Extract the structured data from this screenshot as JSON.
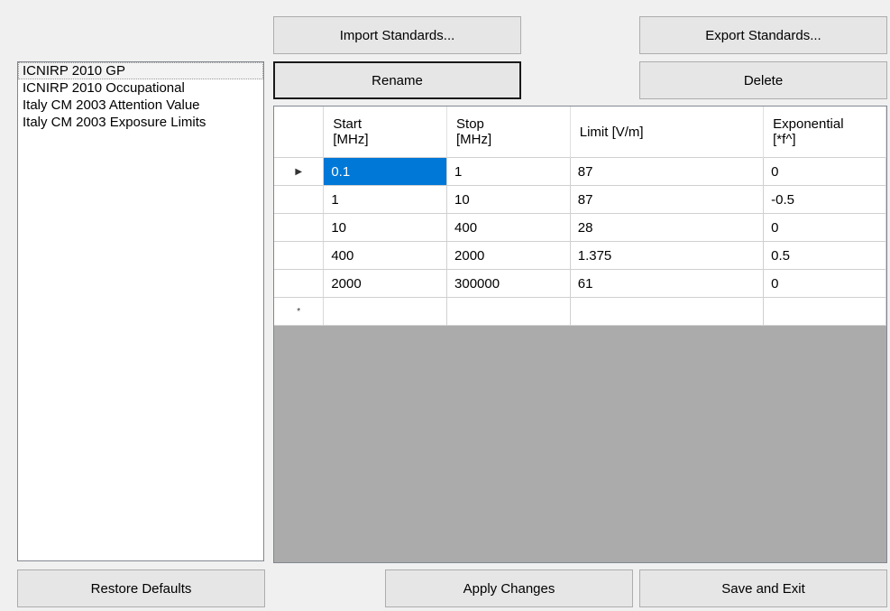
{
  "toolbar": {
    "import_label": "Import Standards...",
    "export_label": "Export Standards...",
    "rename_label": "Rename",
    "delete_label": "Delete"
  },
  "standards_list": [
    "ICNIRP 2010 GP",
    "ICNIRP 2010 Occupational",
    "Italy CM 2003 Attention Value",
    "Italy CM 2003 Exposure Limits"
  ],
  "grid": {
    "columns": [
      {
        "line1": "Start",
        "line2": "[MHz]"
      },
      {
        "line1": "Stop",
        "line2": "[MHz]"
      },
      {
        "line1": "Limit [V/m]",
        "line2": ""
      },
      {
        "line1": "Exponential",
        "line2": "[*f^]"
      }
    ],
    "rows": [
      [
        "0.1",
        "1",
        "87",
        "0"
      ],
      [
        "1",
        "10",
        "87",
        "-0.5"
      ],
      [
        "10",
        "400",
        "28",
        "0"
      ],
      [
        "400",
        "2000",
        "1.375",
        "0.5"
      ],
      [
        "2000",
        "300000",
        "61",
        "0"
      ],
      [
        "",
        "",
        "",
        ""
      ]
    ],
    "current_row_glyph": "▶",
    "new_row_glyph": "*"
  },
  "footer": {
    "restore_label": "Restore Defaults",
    "apply_label": "Apply Changes",
    "save_exit_label": "Save and Exit"
  }
}
